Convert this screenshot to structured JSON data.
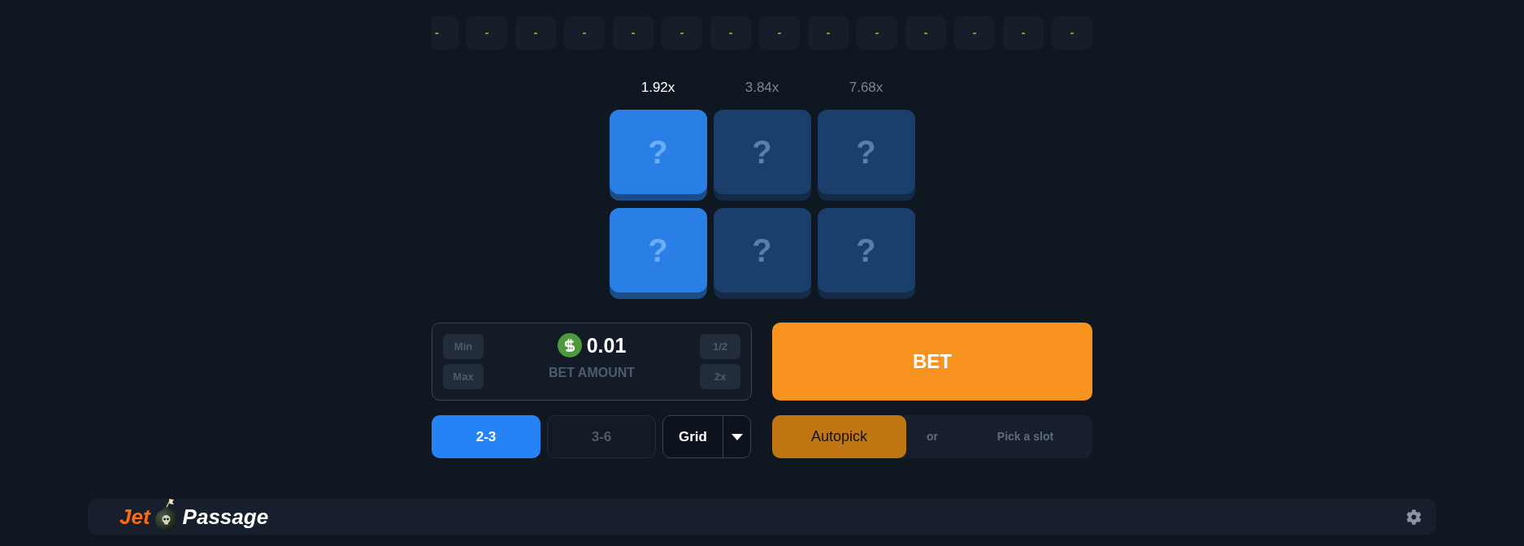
{
  "history": [
    "-",
    "-",
    "-",
    "-",
    "-",
    "-",
    "-",
    "-",
    "-",
    "-",
    "-",
    "-",
    "-",
    "-"
  ],
  "columns": [
    {
      "multiplier": "1.92x",
      "current": true,
      "tiles": [
        "?",
        "?"
      ]
    },
    {
      "multiplier": "3.84x",
      "current": false,
      "tiles": [
        "?",
        "?"
      ]
    },
    {
      "multiplier": "7.68x",
      "current": false,
      "tiles": [
        "?",
        "?"
      ]
    }
  ],
  "bet_amount": {
    "value": "0.01",
    "label": "BET AMOUNT",
    "left_buttons": [
      "Min",
      "Max"
    ],
    "right_buttons": [
      "1/2",
      "2x"
    ]
  },
  "bet_button": {
    "label": "BET"
  },
  "grid_sizes": [
    {
      "label": "2-3",
      "selected": true
    },
    {
      "label": "3-6",
      "selected": false
    }
  ],
  "grid_dropdown": {
    "value": "Grid"
  },
  "pick_mode": {
    "autopick": "Autopick",
    "separator": "or",
    "hint": "Pick a slot"
  },
  "footer": {
    "logo": {
      "first": "Jet",
      "second": "Passage"
    }
  }
}
